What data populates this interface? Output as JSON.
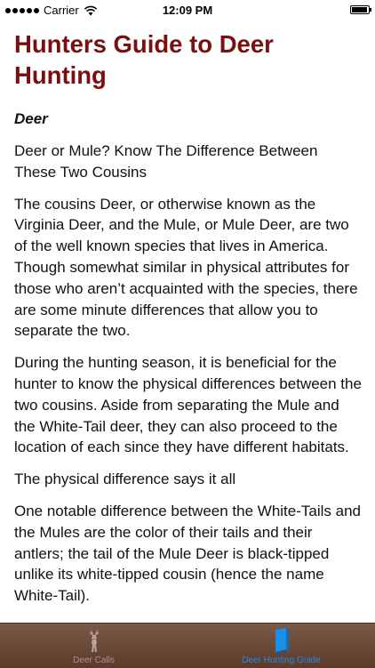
{
  "status_bar": {
    "carrier": "Carrier",
    "time": "12:09 PM",
    "icons": [
      "signal-icon",
      "wifi-icon",
      "battery-icon"
    ]
  },
  "article": {
    "title": "Hunters Guide to Deer Hunting",
    "section_heading": "Deer",
    "paragraphs": [
      "Deer or Mule? Know The Difference Between These Two Cousins",
      "The cousins Deer, or otherwise known as the Virginia Deer, and the Mule, or Mule Deer, are two of the well known species that lives in America. Though somewhat similar in physical attributes for those who aren’t acquainted with the species, there are some minute differences that allow you to separate the two.",
      "During the hunting season, it is beneficial for the hunter to know the physical differences between the two cousins. Aside from separating the Mule and the White-Tail deer, they can also proceed to the location of each since they have different habitats.",
      "The physical difference says it all",
      "One notable difference between the White-Tails and the Mules are the color of their tails and their antlers; the tail of the Mule Deer is black-tipped unlike its white-tipped cousin (hence the name White-Tail)."
    ],
    "title_color": "#7a0f0f"
  },
  "tab_bar": {
    "tabs": [
      {
        "label": "Deer Calls",
        "icon": "deer-icon",
        "selected": false
      },
      {
        "label": "Deer Hunting Guide",
        "icon": "book-icon",
        "selected": true
      }
    ],
    "active_color": "#1b8ee8",
    "background_color": "#6b4a38"
  }
}
